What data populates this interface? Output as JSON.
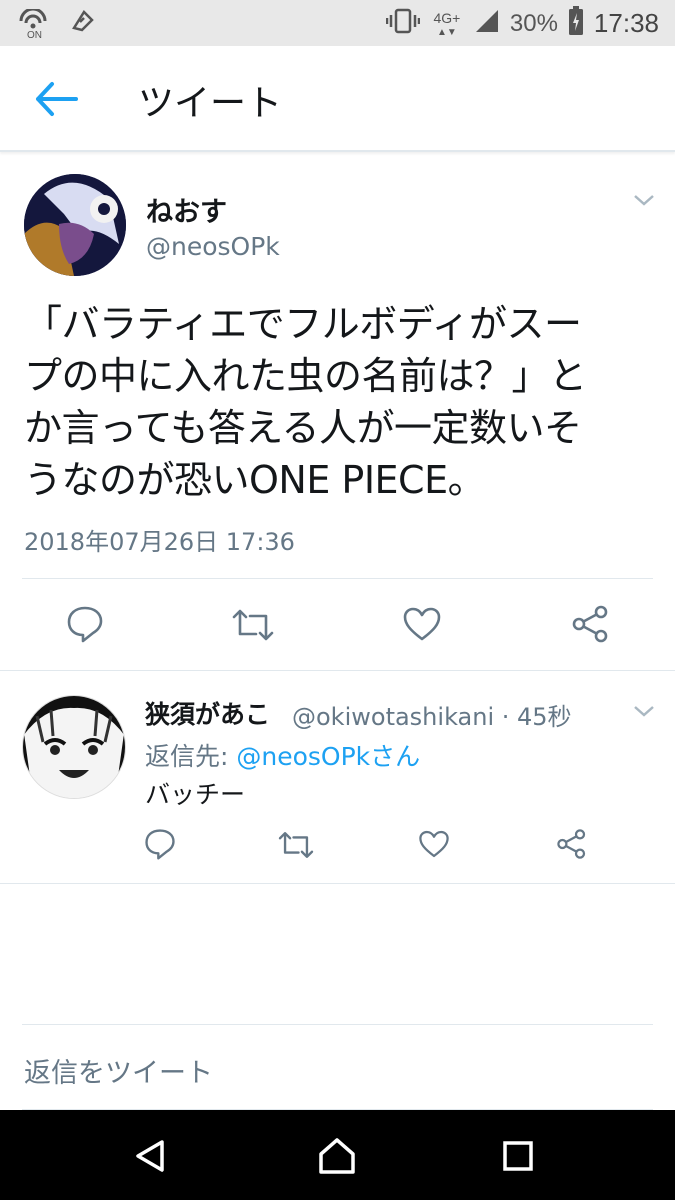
{
  "status_bar": {
    "signal_label": "4G+",
    "battery": "30%",
    "time": "17:38",
    "on_label": "ON"
  },
  "app_bar": {
    "title": "ツイート"
  },
  "tweet": {
    "author_name": "ねおす",
    "author_handle": "@neosOPk",
    "text_lines": [
      "「バラティエでフルボディがスー",
      "プの中に入れた虫の名前は？」と",
      "か言っても答える人が一定数いそ",
      "うなのが恐いONE PIECE。"
    ],
    "timestamp": "2018年07月26日 17:36"
  },
  "reply": {
    "author_name": "狭須があこ",
    "author_handle_time": "@okiwotashikani · 45秒",
    "reply_to_prefix": "返信先: ",
    "reply_to_link": "@neosOPkさん",
    "text": "バッチー"
  },
  "compose": {
    "placeholder": "返信をツイート"
  },
  "colors": {
    "accent": "#1da1f2",
    "secondary_text": "#657786",
    "icon_gray": "#657786",
    "divider": "#e1e8ed"
  }
}
